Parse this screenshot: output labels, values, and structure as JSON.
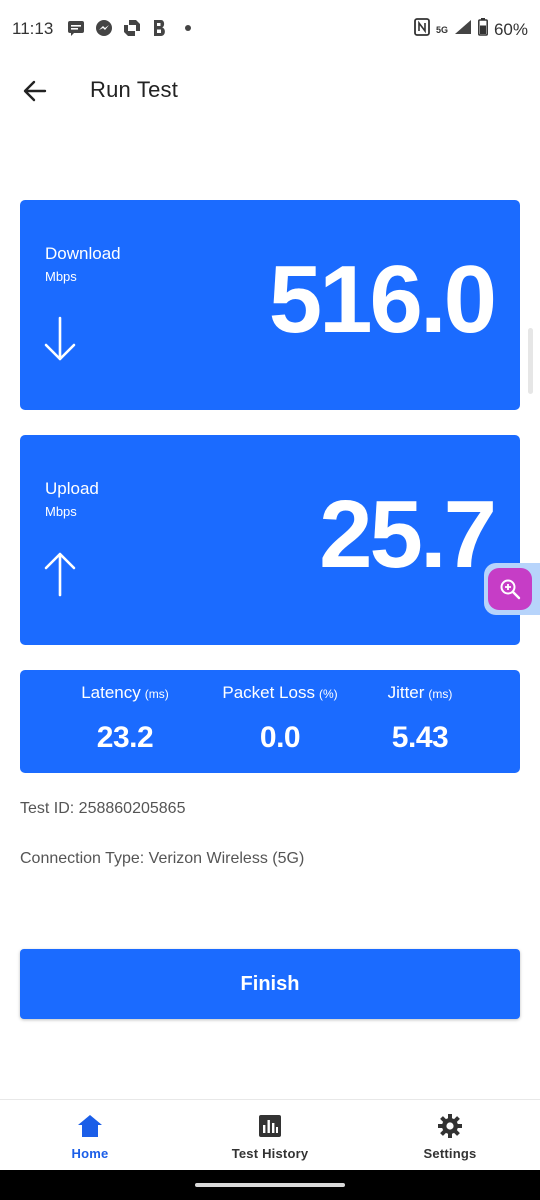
{
  "status_bar": {
    "time": "11:13",
    "notifications": [
      "message-icon",
      "messenger-icon",
      "chase-icon",
      "b-icon",
      "dot-icon"
    ],
    "network_label": "5G",
    "battery": "60%"
  },
  "app_bar": {
    "back_icon": "arrow-left-icon",
    "title": "Run Test"
  },
  "download": {
    "label": "Download",
    "unit": "Mbps",
    "value": "516.0",
    "icon": "arrow-down-icon"
  },
  "upload": {
    "label": "Upload",
    "unit": "Mbps",
    "value": "25.7",
    "icon": "arrow-up-icon"
  },
  "metrics": [
    {
      "label": "Latency",
      "unit": "(ms)",
      "value": "23.2"
    },
    {
      "label": "Packet Loss",
      "unit": "(%)",
      "value": "0.0"
    },
    {
      "label": "Jitter",
      "unit": "(ms)",
      "value": "5.43"
    }
  ],
  "info": {
    "test_id": "Test ID: 258860205865",
    "connection_type": "Connection Type: Verizon Wireless (5G)"
  },
  "finish_button": "Finish",
  "zoom_fab_icon": "zoom-in-icon",
  "bottom_nav": [
    {
      "label": "Home",
      "icon": "home-icon",
      "active": true
    },
    {
      "label": "Test History",
      "icon": "chart-icon",
      "active": false
    },
    {
      "label": "Settings",
      "icon": "gear-icon",
      "active": false
    }
  ],
  "colors": {
    "primary": "#1b6bff",
    "active_nav": "#1b5ee8",
    "zoom_fab": "#c63dc6"
  }
}
